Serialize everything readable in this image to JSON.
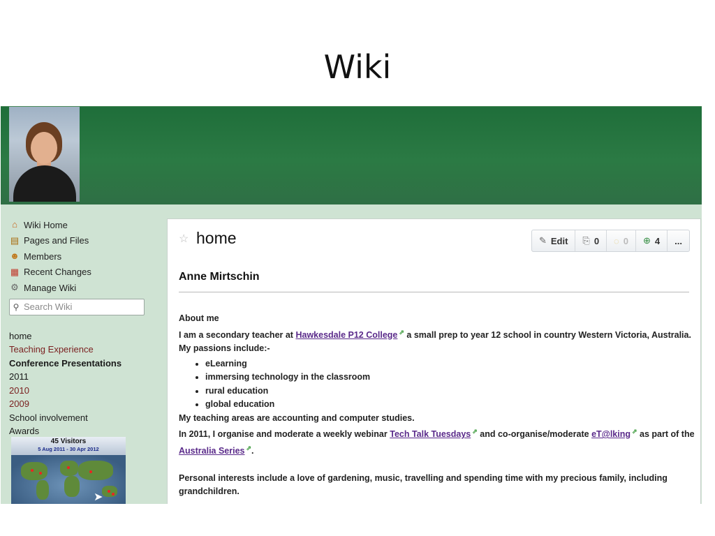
{
  "slide_title": "Wiki",
  "nav": {
    "items": [
      {
        "label": "Wiki Home",
        "icon": "home-icon"
      },
      {
        "label": "Pages and Files",
        "icon": "pages-icon"
      },
      {
        "label": "Members",
        "icon": "members-icon"
      },
      {
        "label": "Recent Changes",
        "icon": "calendar-icon"
      },
      {
        "label": "Manage Wiki",
        "icon": "gear-icon"
      }
    ],
    "search_placeholder": "Search Wiki"
  },
  "page_links": [
    {
      "label": "home",
      "style": "normal"
    },
    {
      "label": "Teaching Experience",
      "style": "red"
    },
    {
      "label": "Conference Presentations",
      "style": "bold"
    },
    {
      "label": "2011",
      "style": "normal"
    },
    {
      "label": "2010",
      "style": "red"
    },
    {
      "label": "2009",
      "style": "red"
    },
    {
      "label": "School involvement",
      "style": "normal"
    },
    {
      "label": "Awards",
      "style": "normal"
    }
  ],
  "visitor_widget": {
    "count": "45 Visitors",
    "range": "5 Aug 2011 - 30 Apr 2012"
  },
  "page": {
    "title": "home",
    "actions": {
      "edit": "Edit",
      "links_count": "0",
      "comments_count": "0",
      "history_count": "4",
      "more": "..."
    },
    "heading": "Anne Mirtschin",
    "about_label": "About me",
    "intro_1": "I am a secondary teacher at",
    "college_link": "Hawkesdale P12 College",
    "intro_2": "a small prep to year 12 school in country Western Victoria, Australia. My passions include:-",
    "passions": [
      "eLearning",
      "immersing technology in the classroom",
      "rural education",
      "global education"
    ],
    "teaching_areas": "My teaching areas are accounting and computer studies.",
    "webinar_1": "In 2011, I organise and moderate a weekly webinar",
    "webinar_link": "Tech Talk Tuesdays",
    "webinar_2": "and co-organise/moderate",
    "etalking_link": "eT@lking",
    "webinar_3": "as part of the",
    "australia_link": "Australia Series",
    "webinar_4": ".",
    "interests": "Personal interests include a love of gardening, music, travelling and spending time with my precious family, including grandchildren."
  },
  "colors": {
    "banner_green": "#2b7a44",
    "sidebar_bg": "#cfe3d3",
    "link_purple": "#5a2a8a",
    "visited_red": "#7a1f1f"
  }
}
